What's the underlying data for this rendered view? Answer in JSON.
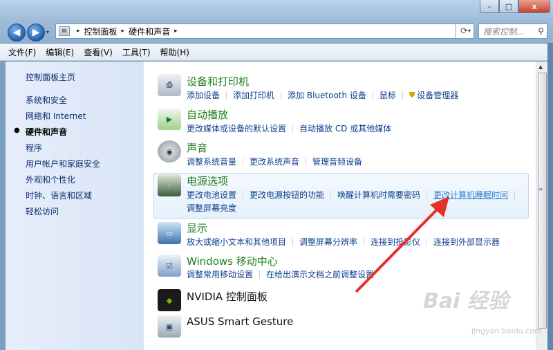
{
  "window": {
    "minimize": "–",
    "maximize": "□",
    "close": "x"
  },
  "nav": {
    "back": "◀",
    "forward": "▶",
    "dropdown": "▾"
  },
  "address": {
    "root_marker": "▸",
    "crumbs": [
      "控制面板",
      "硬件和声音"
    ],
    "dropdown": "▾",
    "refresh": "⟳"
  },
  "search": {
    "placeholder": "搜索控制...",
    "icon": "search-icon"
  },
  "menubar": [
    "文件(F)",
    "编辑(E)",
    "查看(V)",
    "工具(T)",
    "帮助(H)"
  ],
  "sidebar": {
    "items": [
      {
        "label": "控制面板主页",
        "active": false
      },
      {
        "label": "系统和安全",
        "active": false
      },
      {
        "label": "网络和 Internet",
        "active": false
      },
      {
        "label": "硬件和声音",
        "active": true
      },
      {
        "label": "程序",
        "active": false
      },
      {
        "label": "用户帐户和家庭安全",
        "active": false
      },
      {
        "label": "外观和个性化",
        "active": false
      },
      {
        "label": "时钟、语言和区域",
        "active": false
      },
      {
        "label": "轻松访问",
        "active": false
      }
    ],
    "bullet": "●"
  },
  "categories": [
    {
      "title": "设备和打印机",
      "icon": "printer-icon",
      "links": [
        "添加设备",
        "添加打印机",
        "添加 Bluetooth 设备",
        "鼠标",
        "设备管理器"
      ]
    },
    {
      "title": "自动播放",
      "icon": "autoplay-icon",
      "links": [
        "更改媒体或设备的默认设置",
        "自动播放 CD 或其他媒体"
      ]
    },
    {
      "title": "声音",
      "icon": "speaker-icon",
      "links": [
        "调整系统音量",
        "更改系统声音",
        "管理音频设备"
      ]
    },
    {
      "title": "电源选项",
      "icon": "battery-icon",
      "links": [
        "更改电池设置",
        "更改电源按钮的功能",
        "唤醒计算机时需要密码",
        "更改计算机睡眠时间"
      ],
      "links2": [
        "调整屏幕亮度"
      ]
    },
    {
      "title": "显示",
      "icon": "monitor-icon",
      "links": [
        "放大或缩小文本和其他项目",
        "调整屏幕分辨率",
        "连接到投影仪",
        "连接到外部显示器"
      ]
    },
    {
      "title": "Windows 移动中心",
      "icon": "mobility-center-icon",
      "links": [
        "调整常用移动设置",
        "在给出演示文档之前调整设置"
      ]
    },
    {
      "title": "NVIDIA 控制面板",
      "icon": "nvidia-icon",
      "links": []
    },
    {
      "title": "ASUS Smart Gesture",
      "icon": "touchpad-icon",
      "links": []
    }
  ],
  "watermark": {
    "brand": "Bai 经验",
    "url": "jingyan.baidu.com"
  },
  "colors": {
    "category_title": "#1b7e1b",
    "link": "#0d3f8c",
    "arrow": "#e8302a"
  }
}
